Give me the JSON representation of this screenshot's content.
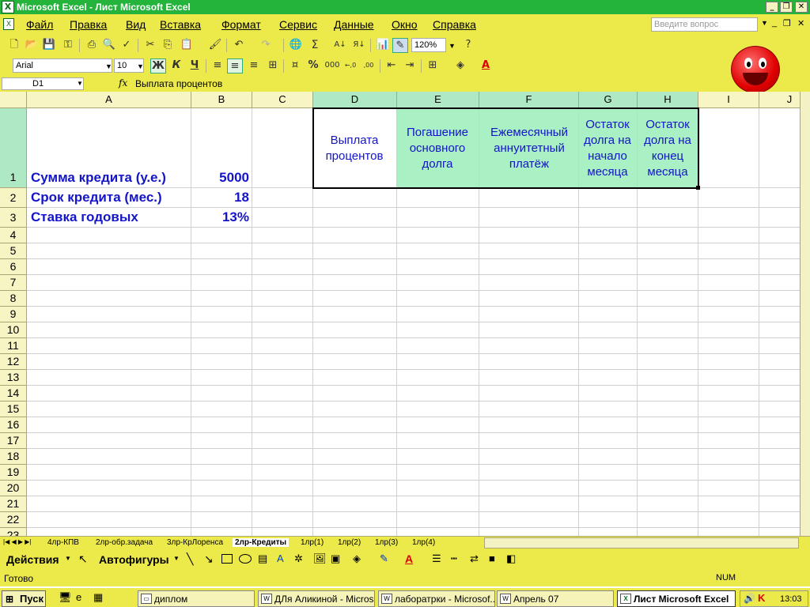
{
  "window": {
    "title": "Microsoft Excel - Лист Microsoft Excel"
  },
  "menu": {
    "items": [
      "Файл",
      "Правка",
      "Вид",
      "Вставка",
      "Формат",
      "Сервис",
      "Данные",
      "Окно",
      "Справка"
    ],
    "ask_placeholder": "Введите вопрос"
  },
  "toolbar": {
    "zoom": "120%",
    "font": "Arial",
    "size": "10",
    "bold": "Ж",
    "italic": "К",
    "underline": "Ч",
    "percent": "%",
    "thousands": "000",
    "inc_decimal": "←,0",
    "dec_decimal": ",00"
  },
  "formula_bar": {
    "cell": "D1",
    "fx": "fx",
    "value": "Выплата процентов"
  },
  "grid": {
    "columns": [
      "A",
      "B",
      "C",
      "D",
      "E",
      "F",
      "G",
      "H",
      "I",
      "J"
    ],
    "rows": [
      "1",
      "2",
      "3",
      "4",
      "5",
      "6",
      "7",
      "8",
      "9",
      "10",
      "11",
      "12",
      "13",
      "14",
      "15",
      "16",
      "17",
      "18",
      "19",
      "20",
      "21",
      "22",
      "23"
    ],
    "cells": {
      "A1": "Сумма кредита (у.е.)",
      "B1": "5000",
      "A2": "Срок кредита (мес.)",
      "B2": "18",
      "A3": "Ставка годовых",
      "B3": "13%",
      "D1": "Выплата процентов",
      "E1": "Погашение основного долга",
      "F1": "Ежемесячный аннуитетный платёж",
      "G1": "Остаток долга на начало месяца",
      "H1": "Остаток долга на конец месяца"
    }
  },
  "sheet_tabs": [
    "4лр-КПВ",
    "2лр-обр.задача",
    "3лр-КрЛоренса",
    "2лр-Кредиты",
    "1лр(1)",
    "1лр(2)",
    "1лр(3)",
    "1лр(4)"
  ],
  "active_tab": "2лр-Кредиты",
  "drawing": {
    "actions": "Действия",
    "autoshapes": "Автофигуры"
  },
  "status": {
    "left": "Готово",
    "num": "NUM"
  },
  "taskbar": {
    "start": "Пуск",
    "tasks": [
      "диплом",
      "ДЛя Аликиной - Micros...",
      "лаборатрки - Microsof...",
      "Апрель 07",
      "Лист Microsoft Excel"
    ],
    "time": "13:03"
  }
}
